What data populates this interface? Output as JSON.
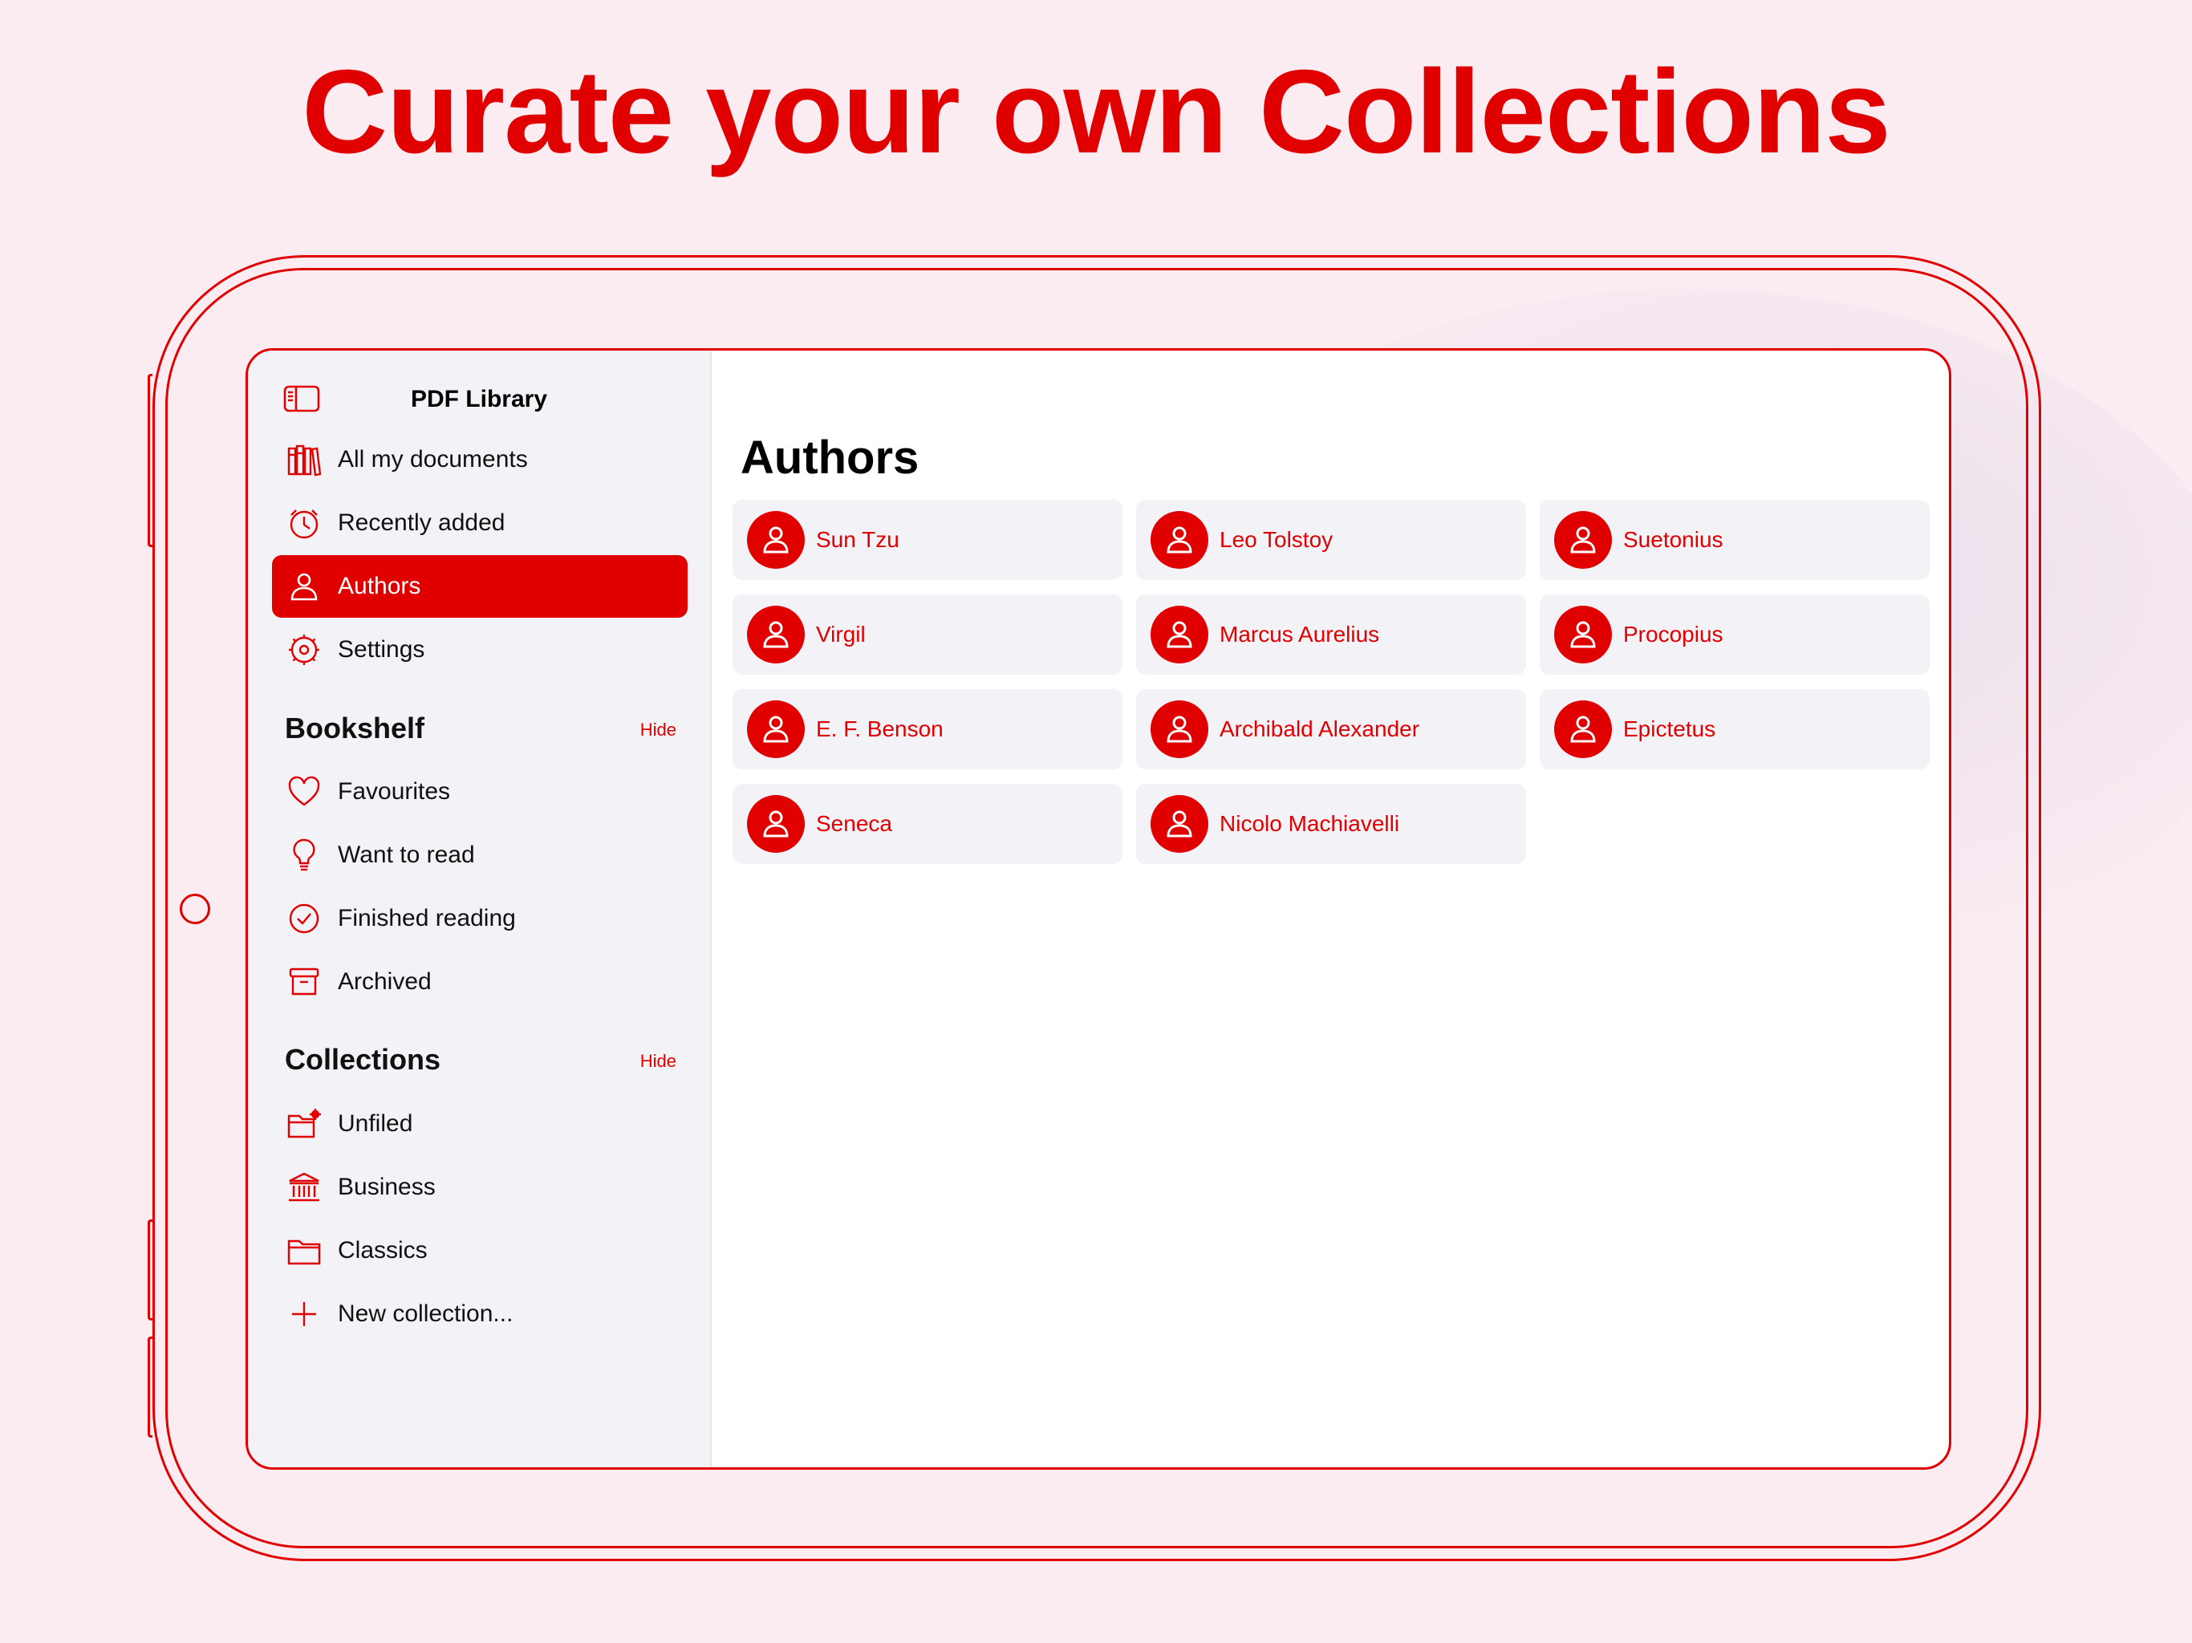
{
  "headline": "Curate your own Collections",
  "colors": {
    "accent": "#e00000",
    "background": "#fbecf2",
    "sidebar": "#f2f2f7",
    "card": "#f2f2f7"
  },
  "app": {
    "title": "PDF Library",
    "toggle_icon": "sidebar-toggle-icon"
  },
  "sidebar": {
    "items": [
      {
        "label": "All my documents",
        "icon": "books-icon"
      },
      {
        "label": "Recently added",
        "icon": "clock-icon"
      },
      {
        "label": "Authors",
        "icon": "person-icon",
        "selected": true
      },
      {
        "label": "Settings",
        "icon": "gear-icon"
      }
    ],
    "bookshelf": {
      "title": "Bookshelf",
      "hide": "Hide",
      "items": [
        {
          "label": "Favourites",
          "icon": "heart-icon"
        },
        {
          "label": "Want to read",
          "icon": "lightbulb-icon"
        },
        {
          "label": "Finished reading",
          "icon": "checkmark-circle-icon"
        },
        {
          "label": "Archived",
          "icon": "archive-box-icon"
        }
      ]
    },
    "collections": {
      "title": "Collections",
      "hide": "Hide",
      "items": [
        {
          "label": "Unfiled",
          "icon": "folder-gear-icon"
        },
        {
          "label": "Business",
          "icon": "bank-icon"
        },
        {
          "label": "Classics",
          "icon": "folder-icon"
        },
        {
          "label": "New collection...",
          "icon": "plus-icon"
        }
      ]
    }
  },
  "main": {
    "title": "Authors",
    "authors": [
      "Sun Tzu",
      "Leo Tolstoy",
      "Suetonius",
      "Virgil",
      "Marcus Aurelius",
      "Procopius",
      "E. F. Benson",
      "Archibald Alexander",
      "Epictetus",
      "Seneca",
      "Nicolo Machiavelli"
    ]
  }
}
